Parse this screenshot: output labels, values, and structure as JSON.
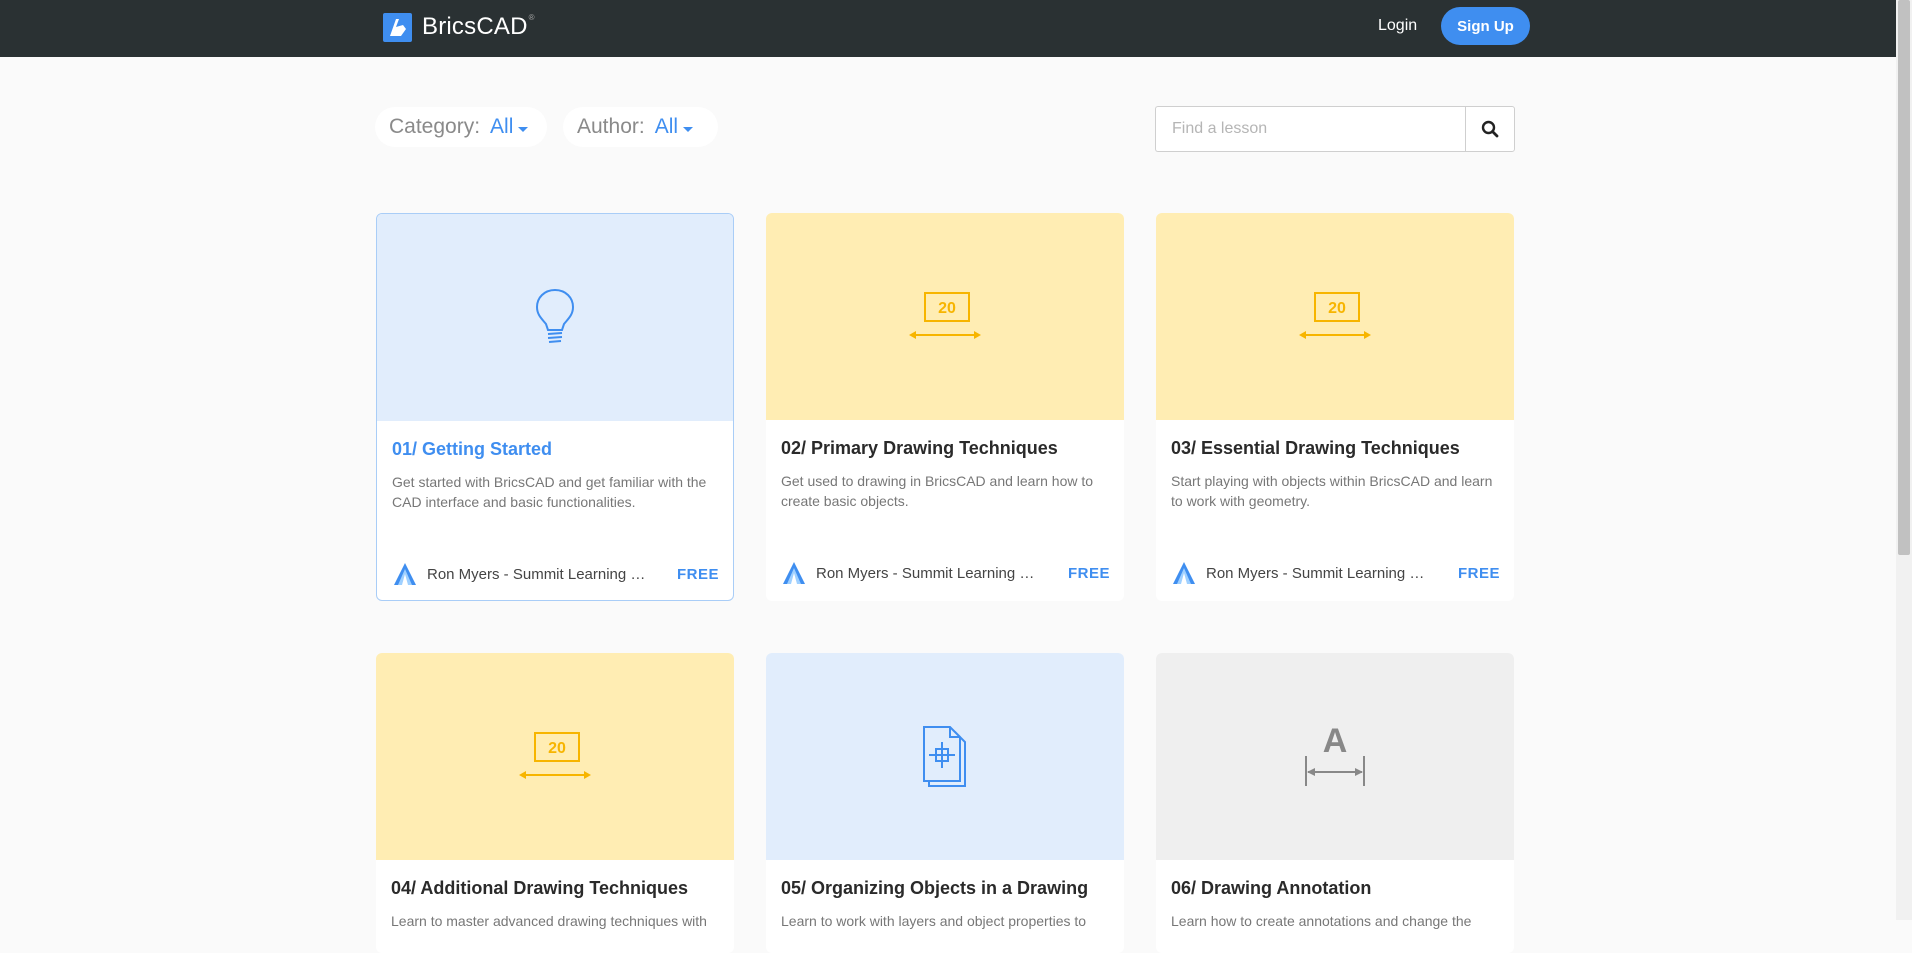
{
  "header": {
    "brand_name": "BricsCAD",
    "brand_mark": "®",
    "login_label": "Login",
    "signup_label": "Sign Up"
  },
  "filters": {
    "category": {
      "label": "Category:",
      "value": "All"
    },
    "author": {
      "label": "Author:",
      "value": "All"
    }
  },
  "search": {
    "placeholder": "Find a lesson",
    "value": ""
  },
  "lessons": [
    {
      "title": "01/ Getting Started",
      "description": "Get started with BricsCAD and get familiar with the CAD interface and basic functionalities.",
      "author": "Ron Myers - Summit Learning & Consulting",
      "price": "FREE",
      "icon": "lightbulb-icon",
      "thumb_color": "#e1edfc"
    },
    {
      "title": "02/ Primary Drawing Techniques",
      "description": "Get used to drawing in BricsCAD and learn how to create basic objects.",
      "author": "Ron Myers - Summit Learning & Consulting",
      "price": "FREE",
      "icon": "dimension-icon",
      "thumb_color": "#ffedb3",
      "icon_text": "20"
    },
    {
      "title": "03/ Essential Drawing Techniques",
      "description": "Start playing with objects within BricsCAD and learn to work with geometry.",
      "author": "Ron Myers - Summit Learning & Consulting",
      "price": "FREE",
      "icon": "dimension-icon",
      "thumb_color": "#ffedb3",
      "icon_text": "20"
    },
    {
      "title": "04/ Additional Drawing Techniques",
      "description": "Learn to master advanced drawing techniques with",
      "icon": "dimension-icon",
      "thumb_color": "#ffedb3",
      "icon_text": "20"
    },
    {
      "title": "05/ Organizing Objects in a Drawing",
      "description": "Learn to work with layers and object properties to",
      "icon": "document-layers-icon",
      "thumb_color": "#e1edfc"
    },
    {
      "title": "06/ Drawing Annotation",
      "description": "Learn how to create annotations and change the",
      "icon": "annotation-icon",
      "thumb_color": "#efefef",
      "icon_text": "A"
    }
  ],
  "colors": {
    "accent": "#3f8ef0",
    "header_bg": "#2a3133",
    "yellow_icon": "#f7b500",
    "grey_icon": "#888888"
  }
}
